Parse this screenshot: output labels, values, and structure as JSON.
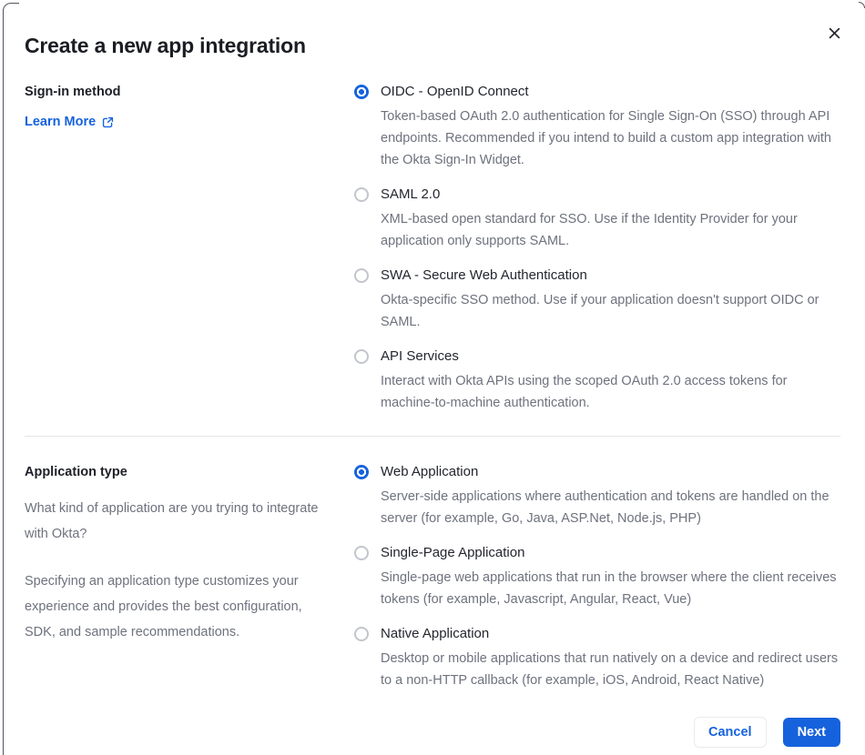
{
  "dialog": {
    "title": "Create a new app integration"
  },
  "colors": {
    "accent_blue": "#1662dd",
    "text_dark": "#1d1f27",
    "text_gray": "#6e727e",
    "divider": "#e5e6e9"
  },
  "icons": {
    "close": "close-icon",
    "external_link": "external-link-icon",
    "radio_selected": "radio-selected-icon",
    "radio_unselected": "radio-unselected-icon"
  },
  "sign_in_section": {
    "label": "Sign-in method",
    "link_label": "Learn More",
    "options": [
      {
        "label": "OIDC - OpenID Connect",
        "description": "Token-based OAuth 2.0 authentication for Single Sign-On (SSO) through API endpoints. Recommended if you intend to build a custom app integration with the Okta Sign-In Widget.",
        "selected": true
      },
      {
        "label": "SAML 2.0",
        "description": "XML-based open standard for SSO. Use if the Identity Provider for your application only supports SAML.",
        "selected": false
      },
      {
        "label": "SWA - Secure Web Authentication",
        "description": "Okta-specific SSO method. Use if your application doesn't support OIDC or SAML.",
        "selected": false
      },
      {
        "label": "API Services",
        "description": "Interact with Okta APIs using the scoped OAuth 2.0 access tokens for machine-to-machine authentication.",
        "selected": false
      }
    ]
  },
  "app_type_section": {
    "label": "Application type",
    "paragraphs": [
      "What kind of application are you trying to integrate with Okta?",
      "Specifying an application type customizes your experience and provides the best configuration, SDK, and sample recommendations."
    ],
    "options": [
      {
        "label": "Web Application",
        "description": "Server-side applications where authentication and tokens are handled on the server (for example, Go, Java, ASP.Net, Node.js, PHP)",
        "selected": true
      },
      {
        "label": "Single-Page Application",
        "description": "Single-page web applications that run in the browser where the client receives tokens (for example, Javascript, Angular, React, Vue)",
        "selected": false
      },
      {
        "label": "Native Application",
        "description": "Desktop or mobile applications that run natively on a device and redirect users to a non-HTTP callback (for example, iOS, Android, React Native)",
        "selected": false
      }
    ]
  },
  "footer": {
    "cancel_label": "Cancel",
    "next_label": "Next"
  }
}
